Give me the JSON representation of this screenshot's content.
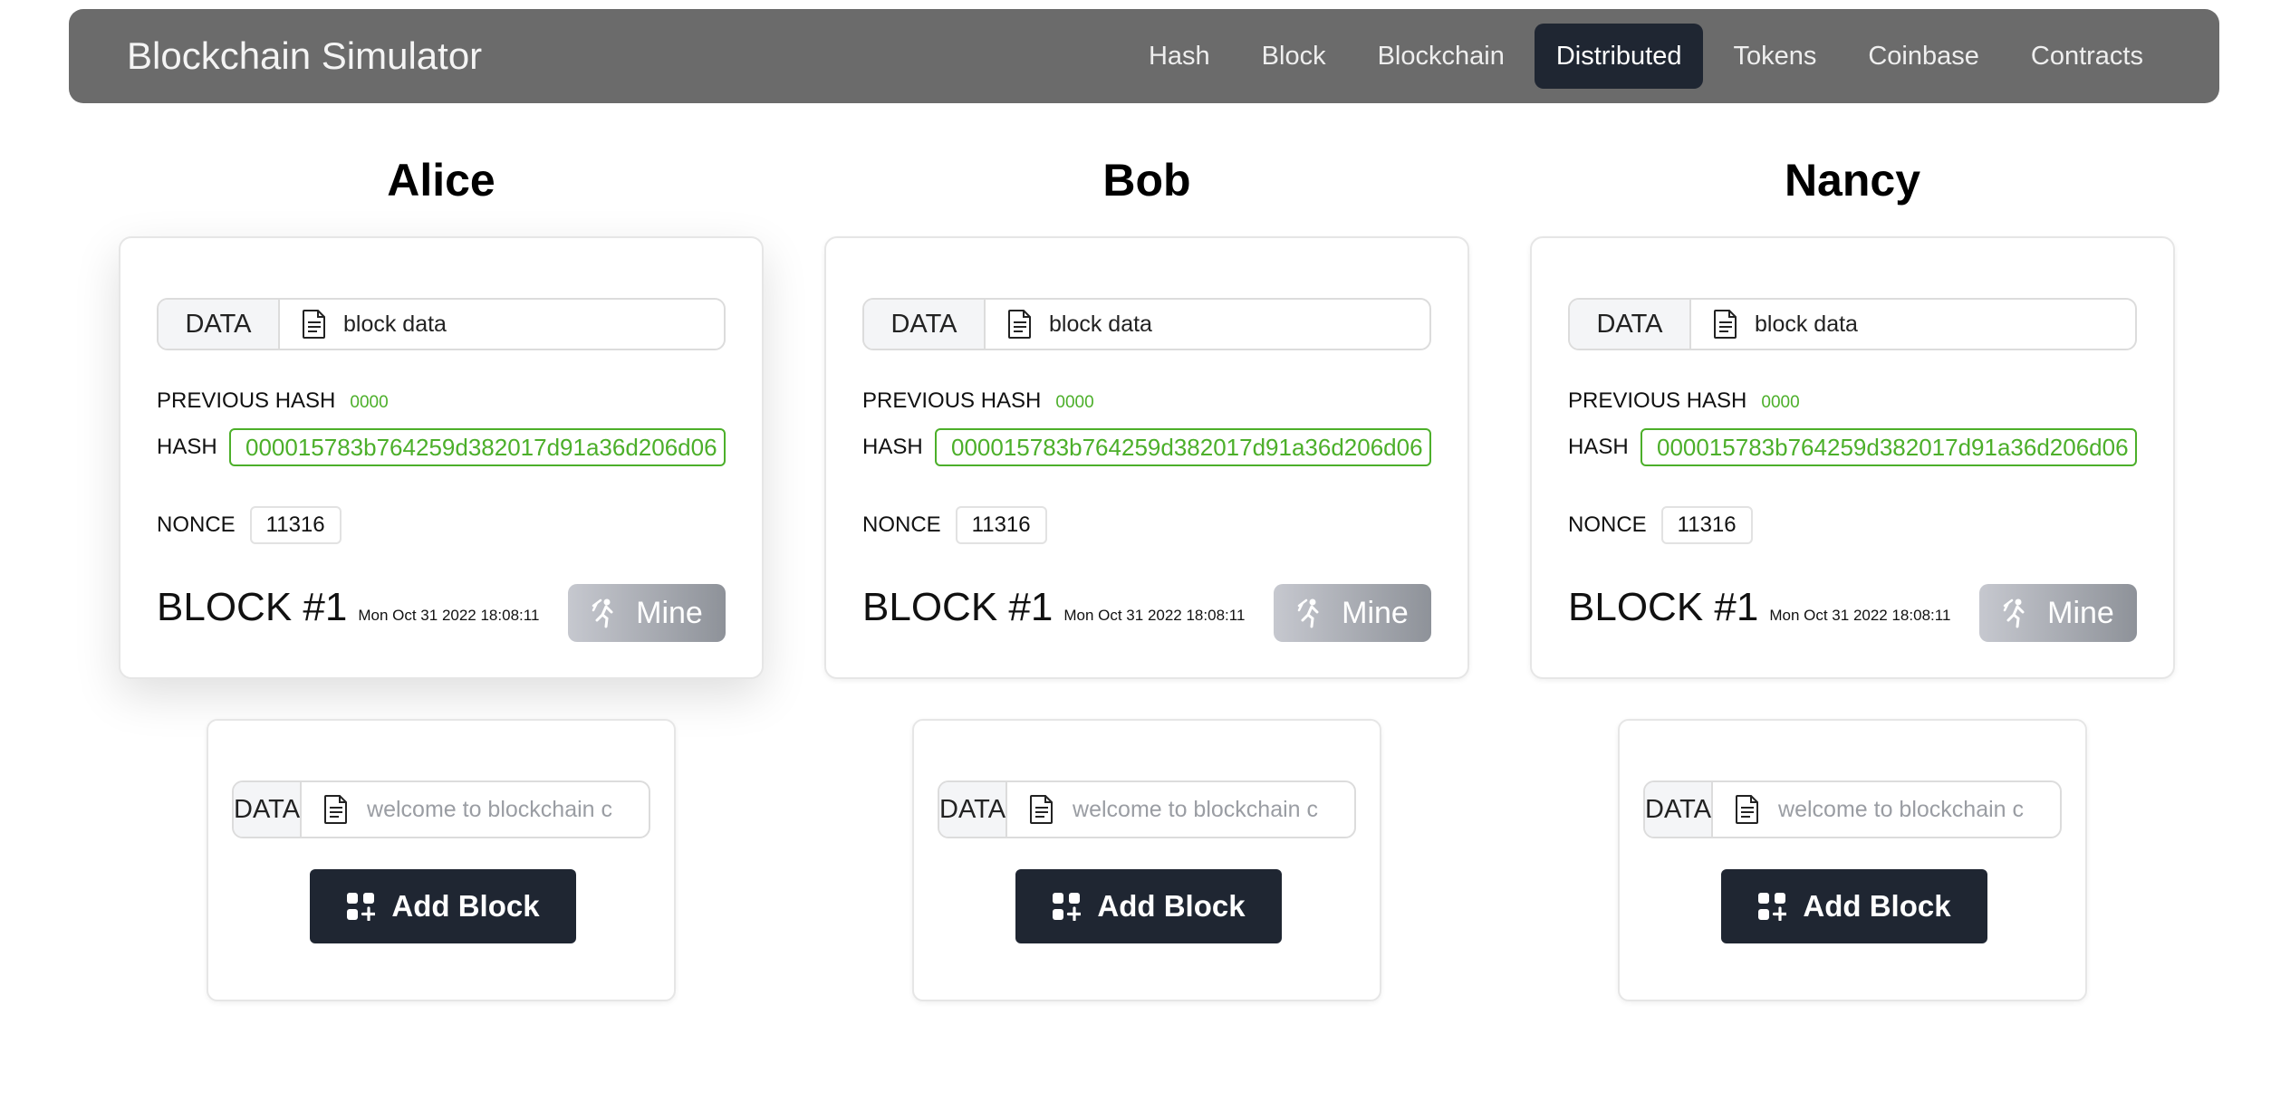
{
  "app": {
    "title": "Blockchain Simulator"
  },
  "nav": {
    "items": [
      {
        "label": "Hash"
      },
      {
        "label": "Block"
      },
      {
        "label": "Blockchain"
      },
      {
        "label": "Distributed",
        "active": true
      },
      {
        "label": "Tokens"
      },
      {
        "label": "Coinbase"
      },
      {
        "label": "Contracts"
      }
    ]
  },
  "peers": [
    {
      "name": "Alice",
      "block": {
        "data_label": "DATA",
        "data_value": "block data",
        "previous_hash_label": "PREVIOUS HASH",
        "previous_hash": "0000",
        "hash_label": "HASH",
        "hash": "000015783b764259d382017d91a36d206d06",
        "nonce_label": "NONCE",
        "nonce": "11316",
        "title": "BLOCK #1",
        "timestamp": "Mon Oct 31 2022 18:08:11",
        "mine_label": "Mine"
      },
      "add": {
        "data_label": "DATA",
        "placeholder": "welcome to blockchain c",
        "button_label": "Add Block"
      }
    },
    {
      "name": "Bob",
      "block": {
        "data_label": "DATA",
        "data_value": "block data",
        "previous_hash_label": "PREVIOUS HASH",
        "previous_hash": "0000",
        "hash_label": "HASH",
        "hash": "000015783b764259d382017d91a36d206d06",
        "nonce_label": "NONCE",
        "nonce": "11316",
        "title": "BLOCK #1",
        "timestamp": "Mon Oct 31 2022 18:08:11",
        "mine_label": "Mine"
      },
      "add": {
        "data_label": "DATA",
        "placeholder": "welcome to blockchain c",
        "button_label": "Add Block"
      }
    },
    {
      "name": "Nancy",
      "block": {
        "data_label": "DATA",
        "data_value": "block data",
        "previous_hash_label": "PREVIOUS HASH",
        "previous_hash": "0000",
        "hash_label": "HASH",
        "hash": "000015783b764259d382017d91a36d206d06",
        "nonce_label": "NONCE",
        "nonce": "11316",
        "title": "BLOCK #1",
        "timestamp": "Mon Oct 31 2022 18:08:11",
        "mine_label": "Mine"
      },
      "add": {
        "data_label": "DATA",
        "placeholder": "welcome to blockchain c",
        "button_label": "Add Block"
      }
    }
  ],
  "colors": {
    "navbar": "#6b6b6b",
    "active_nav": "#1f2632",
    "valid_hash": "#4caf2a",
    "add_button": "#1f2632"
  },
  "icons": {
    "data_field": "document-icon",
    "mine_button": "pickaxe-miner-icon",
    "add_button": "grid-plus-icon"
  }
}
